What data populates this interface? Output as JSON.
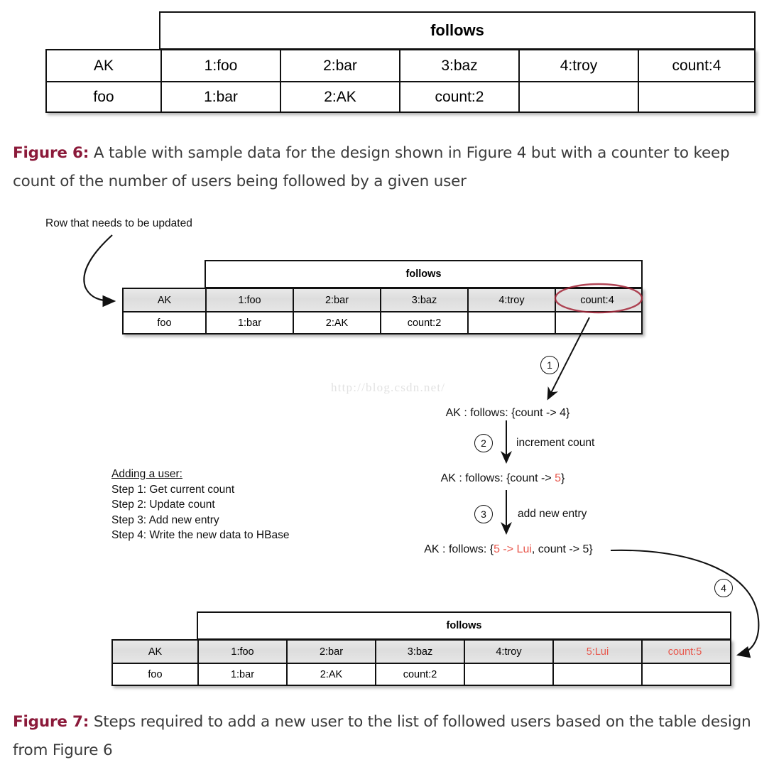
{
  "figure6": {
    "table": {
      "column_family_header": "follows",
      "rows": [
        {
          "shaded": false,
          "cells": [
            "AK",
            "1:foo",
            "2:bar",
            "3:baz",
            "4:troy",
            "count:4"
          ]
        },
        {
          "shaded": false,
          "cells": [
            "foo",
            "1:bar",
            "2:AK",
            "count:2",
            "",
            ""
          ]
        }
      ]
    },
    "caption": {
      "label": "Figure 6:",
      "text": " A table with sample data for the design shown in Figure 4 but with a counter to keep count of the number of users being followed by a given user"
    }
  },
  "figure7": {
    "annotation_note": "Row that needs to be updated",
    "table_before": {
      "column_family_header": "follows",
      "rows": [
        {
          "shaded": true,
          "cells": [
            "AK",
            "1:foo",
            "2:bar",
            "3:baz",
            "4:troy",
            "count:4"
          ]
        },
        {
          "shaded": false,
          "cells": [
            "foo",
            "1:bar",
            "2:AK",
            "count:2",
            "",
            ""
          ]
        }
      ],
      "highlighted_cell": "count:4"
    },
    "flow": {
      "line1": {
        "prefix": "AK : follows: {count -> 4}",
        "highlight": "",
        "suffix": ""
      },
      "line2": {
        "prefix": "AK : follows: {count -> ",
        "highlight": "5",
        "suffix": "}"
      },
      "line3": {
        "prefix": "AK : follows: {",
        "highlight": "5 -> Lui",
        "suffix": ", count -> 5}"
      },
      "step1_label": "1",
      "step2_label": "2",
      "step2_text": "increment count",
      "step3_label": "3",
      "step3_text": "add new entry",
      "step4_label": "4"
    },
    "steps_list": {
      "title": "Adding a user:",
      "items": [
        "Step 1: Get current count",
        "Step 2: Update count",
        "Step 3: Add new entry",
        "Step 4: Write the new data to HBase"
      ]
    },
    "table_after": {
      "column_family_header": "follows",
      "rows": [
        {
          "shaded": true,
          "cells": [
            "AK",
            "1:foo",
            "2:bar",
            "3:baz",
            "4:troy",
            "5:Lui",
            "count:5"
          ],
          "red_indices": [
            5,
            6
          ]
        },
        {
          "shaded": false,
          "cells": [
            "foo",
            "1:bar",
            "2:AK",
            "count:2",
            "",
            "",
            ""
          ],
          "red_indices": []
        }
      ]
    },
    "caption": {
      "label": "Figure 7:",
      "text": " Steps required to add a new user to the list of followed users based on the table design from Figure 6"
    }
  },
  "watermark": "http://blog.csdn.net/",
  "colors": {
    "figure_label": "#8b1a3a",
    "highlight_red": "#e8574c",
    "ellipse_red": "#a32638",
    "border": "#111111",
    "shaded_row": "#e3e3e3"
  }
}
